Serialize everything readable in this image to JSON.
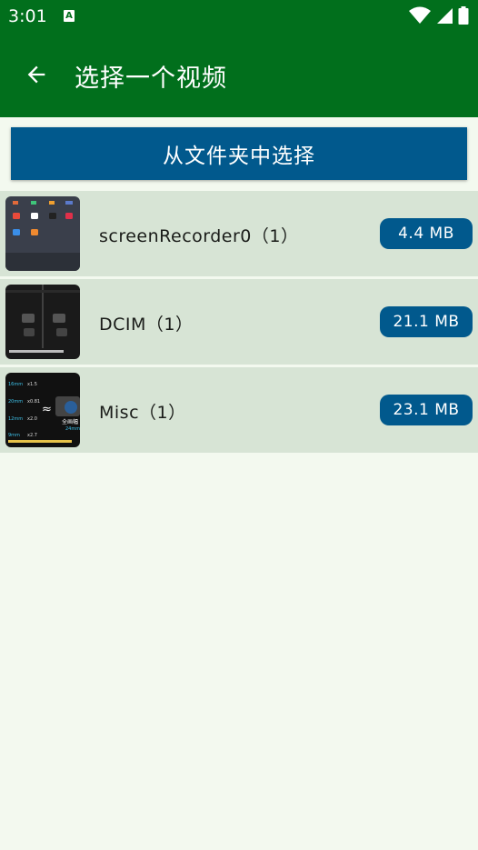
{
  "status_bar": {
    "time": "3:01",
    "notification_icon": "a-icon",
    "icons": [
      "wifi-icon",
      "signal-icon",
      "battery-icon"
    ]
  },
  "app_bar": {
    "back_icon": "arrow-left-icon",
    "title": "选择一个视频"
  },
  "actions": {
    "choose_from_folder": "从文件夹中选择"
  },
  "folders": [
    {
      "name": "screenRecorder0（1）",
      "size": "4.4 MB"
    },
    {
      "name": "DCIM（1）",
      "size": "21.1 MB"
    },
    {
      "name": "Misc（1）",
      "size": "23.1 MB"
    }
  ],
  "thumbnails": {
    "misc_labels": [
      "16mm",
      "x1.5",
      "20mm",
      "x0.81",
      "12mm",
      "x2.0",
      "9mm",
      "x2.7",
      "全画幅",
      "24mm"
    ]
  },
  "colors": {
    "primary_green": "#016f1c",
    "button_blue": "#01598d",
    "row_background": "#d7e4d5",
    "page_background": "#f3f9ef"
  }
}
